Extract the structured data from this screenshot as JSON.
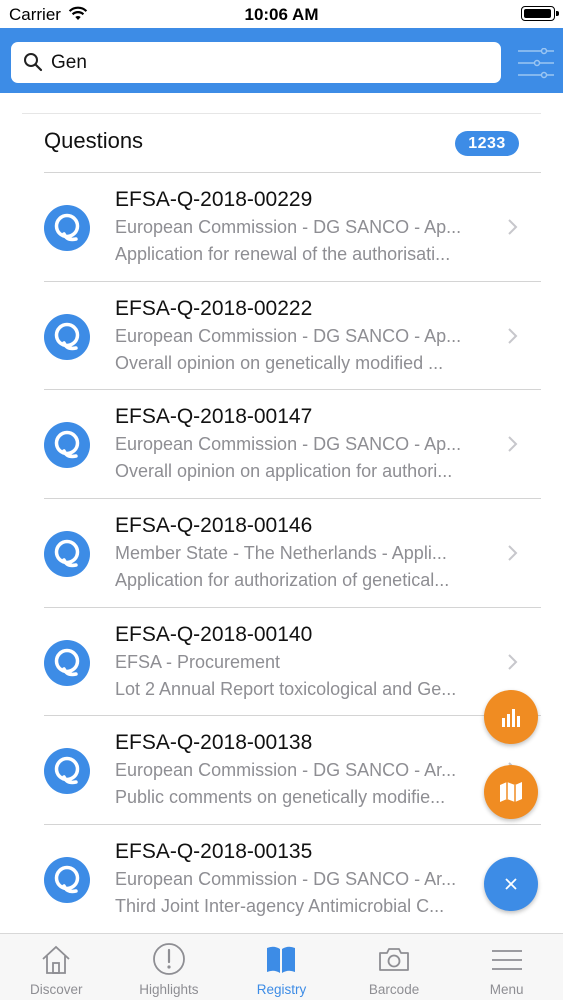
{
  "status_bar": {
    "carrier": "Carrier",
    "time": "10:06 AM"
  },
  "search": {
    "value": "Gen",
    "placeholder": ""
  },
  "section": {
    "title": "Questions",
    "count": "1233"
  },
  "items": [
    {
      "title": "EFSA-Q-2018-00229",
      "subtitle": "European Commission - DG SANCO - Ap...",
      "description": "Application for renewal of the authorisati..."
    },
    {
      "title": "EFSA-Q-2018-00222",
      "subtitle": "European Commission - DG SANCO - Ap...",
      "description": "Overall opinion on genetically modified ..."
    },
    {
      "title": "EFSA-Q-2018-00147",
      "subtitle": "European Commission - DG SANCO - Ap...",
      "description": "Overall opinion on application for authori..."
    },
    {
      "title": "EFSA-Q-2018-00146",
      "subtitle": "Member State - The Netherlands - Appli...",
      "description": "Application for authorization of genetical..."
    },
    {
      "title": "EFSA-Q-2018-00140",
      "subtitle": "EFSA - Procurement",
      "description": "Lot 2 Annual Report toxicological and Ge..."
    },
    {
      "title": "EFSA-Q-2018-00138",
      "subtitle": "European Commission - DG SANCO - Ar...",
      "description": "Public comments on genetically modifie..."
    },
    {
      "title": "EFSA-Q-2018-00135",
      "subtitle": "European Commission - DG SANCO - Ar...",
      "description": "Third Joint Inter-agency Antimicrobial C..."
    }
  ],
  "tabs": [
    {
      "label": "Discover",
      "icon": "house-icon",
      "active": false
    },
    {
      "label": "Highlights",
      "icon": "exclamation-circle-icon",
      "active": false
    },
    {
      "label": "Registry",
      "icon": "book-icon",
      "active": true
    },
    {
      "label": "Barcode",
      "icon": "camera-icon",
      "active": false
    },
    {
      "label": "Menu",
      "icon": "hamburger-icon",
      "active": false
    }
  ],
  "colors": {
    "brand_blue": "#3d8ce6",
    "fab_orange": "#f08c22",
    "secondary_text": "#8e8e93"
  }
}
